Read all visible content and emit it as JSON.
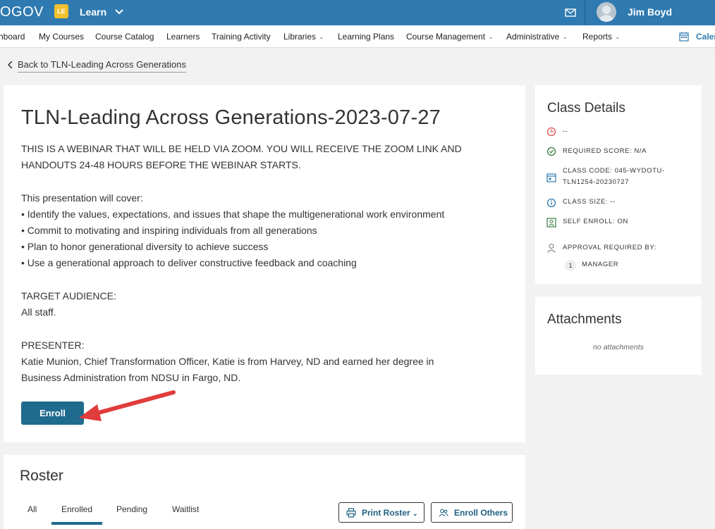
{
  "header": {
    "brand": "OGOV",
    "app_badge": "LE",
    "app_menu": "Learn",
    "user_name": "Jim Boyd"
  },
  "nav": {
    "items": [
      {
        "label": "hboard",
        "has_menu": false
      },
      {
        "label": "My Courses",
        "has_menu": false
      },
      {
        "label": "Course Catalog",
        "has_menu": false
      },
      {
        "label": "Learners",
        "has_menu": false
      },
      {
        "label": "Training Activity",
        "has_menu": false
      },
      {
        "label": "Libraries",
        "has_menu": true
      },
      {
        "label": "Learning Plans",
        "has_menu": false
      },
      {
        "label": "Course Management",
        "has_menu": true
      },
      {
        "label": "Administrative",
        "has_menu": true
      },
      {
        "label": "Reports",
        "has_menu": true
      }
    ],
    "calendar_label": "Calen"
  },
  "back_link": "Back to TLN-Leading Across Generations",
  "course": {
    "title": "TLN-Leading Across Generations-2023-07-27",
    "description_lines": [
      "THIS IS A WEBINAR THAT WILL BE HELD VIA ZOOM. YOU WILL RECEIVE THE ZOOM LINK AND",
      "HANDOUTS 24-48 HOURS BEFORE THE WEBINAR STARTS.",
      "This presentation will cover:",
      "• Identify the values, expectations, and issues that shape the multigenerational work environment",
      "• Commit to motivating and inspiring individuals from all generations",
      "• Plan to honor generational diversity to achieve success",
      "• Use a generational approach to deliver constructive feedback and coaching",
      "TARGET AUDIENCE:",
      "All staff.",
      "PRESENTER:",
      "Katie Munion, Chief Transformation Officer, Katie is from Harvey, ND and earned her degree in",
      "Business Administration from NDSU in Fargo, ND."
    ],
    "enroll_label": "Enroll"
  },
  "class_details": {
    "title": "Class Details",
    "time": "--",
    "required_score": "REQUIRED SCORE: N/A",
    "class_code_line1": "CLASS CODE: 045-WYDOTU-",
    "class_code_line2": "TLN1254-20230727",
    "class_size": "CLASS SIZE: --",
    "self_enroll": "SELF ENROLL: ON",
    "approval_label": "APPROVAL REQUIRED BY:",
    "approver_number": "1",
    "approver_role": "MANAGER"
  },
  "attachments": {
    "title": "Attachments",
    "empty_text": "no attachments"
  },
  "roster": {
    "title": "Roster",
    "tabs": [
      "All",
      "Enrolled",
      "Pending",
      "Waitlist"
    ],
    "active_tab": "Enrolled",
    "print_label": "Print Roster",
    "enroll_others_label": "Enroll Others"
  },
  "colors": {
    "header_bg": "#2f7ab0",
    "primary_button": "#1f6b8e",
    "badge": "#f2c12e",
    "annotation_arrow": "#e03c3c",
    "clock_icon": "#d9534f",
    "check_icon": "#3a7d44"
  },
  "icons": {
    "mail": "mail-icon",
    "calendar": "calendar-icon",
    "back": "chevron-left-icon",
    "time": "clock-icon",
    "score": "check-circle-icon",
    "code": "calendar-code-icon",
    "size": "info-icon",
    "self_enroll": "person-card-icon",
    "approval": "person-icon",
    "print": "printer-icon",
    "enroll_others": "users-icon"
  }
}
